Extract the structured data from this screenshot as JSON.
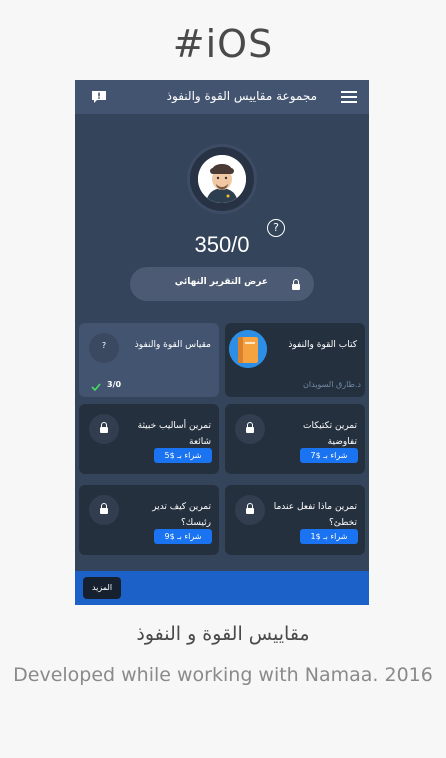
{
  "header": {
    "platform": "#iOS"
  },
  "app": {
    "title": "مجموعة مقاييس القوة  والنفوذ",
    "score": "350/0",
    "help_symbol": "?",
    "report_button": "عرض التقرير النهائي"
  },
  "cards": [
    {
      "title": "كتاب القوة والنفوذ",
      "author": "د.طارق السويدان"
    },
    {
      "title": "مقياس القوة والنفوذ",
      "icon_symbol": "?",
      "progress": "3/0"
    },
    {
      "title": "تمرين تكتيكات تفاوضية",
      "price_label": "شراء بـ $7"
    },
    {
      "title": "تمرين أساليب خبيثة شائعة",
      "price_label": "شراء بـ $5"
    },
    {
      "title": "تمرين ماذا تفعل عندما تخطئ؟",
      "price_label": "شراء بـ $1"
    },
    {
      "title": "تمرين كيف تدير رئيسك؟",
      "price_label": "شراء بـ $9"
    }
  ],
  "footer": {
    "more_button": "المزيد"
  },
  "caption": {
    "app_name": "مقاييس القوة و النفوذ",
    "description": "Developed while working with Namaa. 2016"
  },
  "colors": {
    "background": "#34445a",
    "topbar": "#435470",
    "card": "#25303e",
    "accent": "#1a73f0",
    "bottombar": "#1c61c8"
  }
}
